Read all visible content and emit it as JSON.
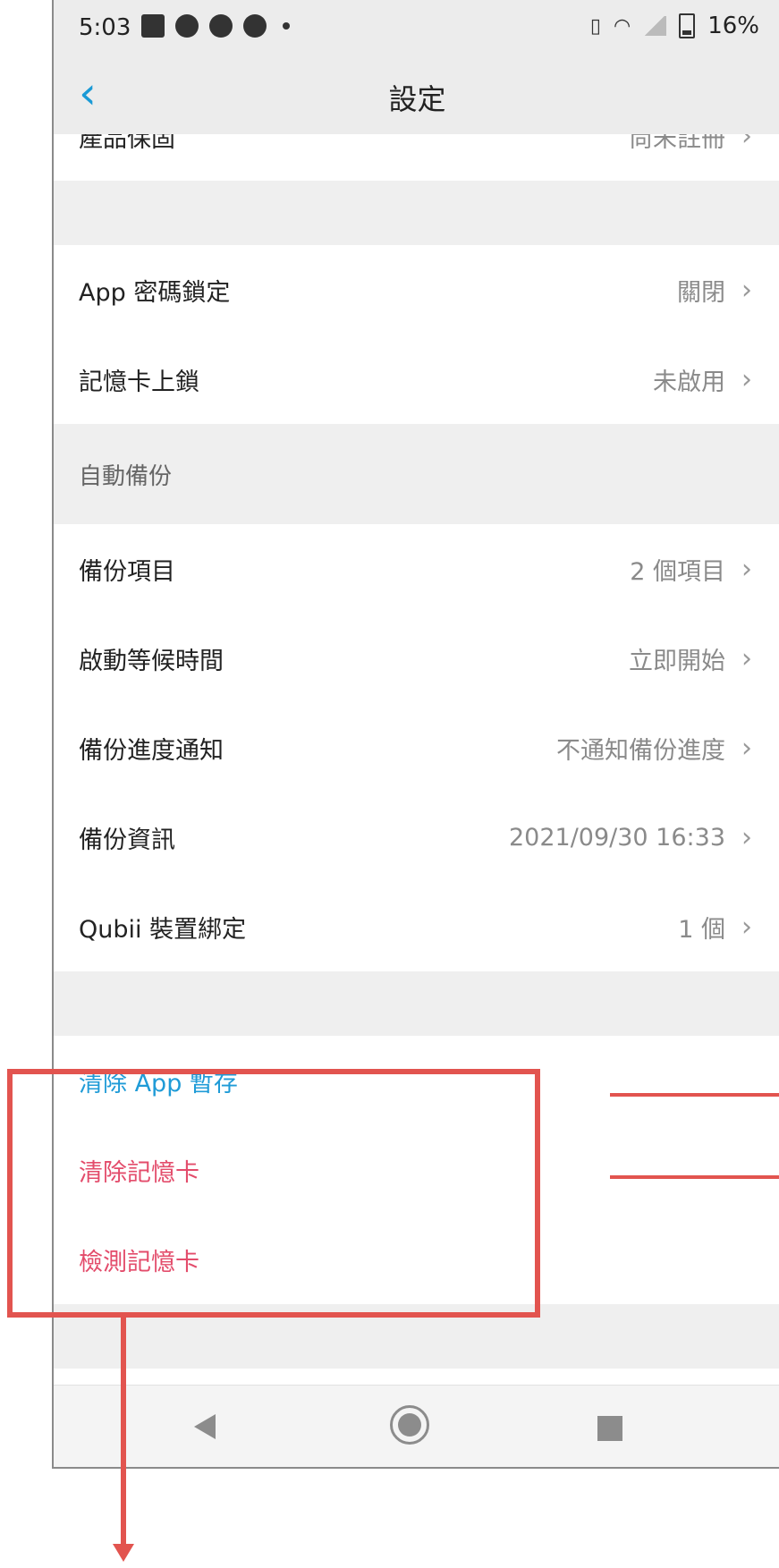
{
  "status_bar": {
    "time": "5:03",
    "battery": "16%"
  },
  "nav": {
    "back_icon": "chevron-left",
    "title": "設定"
  },
  "rows_top": [
    {
      "label": "產品保固",
      "value": "尚未註冊"
    }
  ],
  "security": [
    {
      "label": "App 密碼鎖定",
      "value": "關閉"
    },
    {
      "label": "記憶卡上鎖",
      "value": "未啟用"
    }
  ],
  "backup": {
    "header": "自動備份",
    "rows": [
      {
        "label": "備份項目",
        "value": "2 個項目"
      },
      {
        "label": "啟動等候時間",
        "value": "立即開始"
      },
      {
        "label": "備份進度通知",
        "value": "不通知備份進度"
      },
      {
        "label": "備份資訊",
        "value": "2021/09/30 16:33"
      },
      {
        "label": "Qubii 裝置綁定",
        "value": "1 個"
      }
    ]
  },
  "actions": {
    "clear_cache": "清除 App 暫存",
    "clear_card": "清除記憶卡",
    "check_card": "檢測記憶卡"
  },
  "colors": {
    "accent_blue": "#1f9bd7",
    "danger_red": "#e34c6b",
    "annotation": "#e2544f"
  }
}
